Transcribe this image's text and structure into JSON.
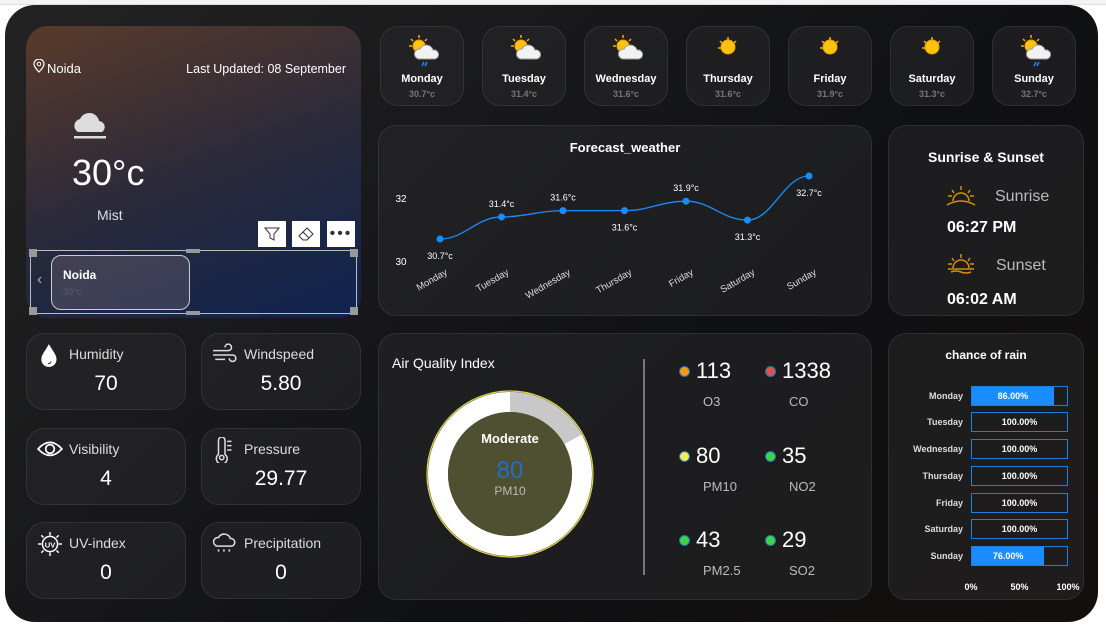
{
  "location": {
    "city": "Noida",
    "last_updated": "Last Updated: 08 September",
    "temp": "30°c",
    "condition": "Mist",
    "icon": "cloud-icon"
  },
  "slicer": {
    "item": "Noida",
    "sub": "30°c"
  },
  "days": [
    {
      "name": "Monday",
      "temp": "30.7°c",
      "icon": "sun-cloud-rain"
    },
    {
      "name": "Tuesday",
      "temp": "31.4°c",
      "icon": "sun-cloud"
    },
    {
      "name": "Wednesday",
      "temp": "31.6°c",
      "icon": "sun-cloud"
    },
    {
      "name": "Thursday",
      "temp": "31.6°c",
      "icon": "sun"
    },
    {
      "name": "Friday",
      "temp": "31.9°c",
      "icon": "sun"
    },
    {
      "name": "Saturday",
      "temp": "31.3°c",
      "icon": "sun"
    },
    {
      "name": "Sunday",
      "temp": "32.7°c",
      "icon": "sun-cloud-rain"
    }
  ],
  "chart_data": {
    "type": "line",
    "title": "Forecast_weather",
    "categories": [
      "Monday",
      "Tuesday",
      "Wednesday",
      "Thursday",
      "Friday",
      "Saturday",
      "Sunday"
    ],
    "values": [
      30.7,
      31.4,
      31.6,
      31.6,
      31.9,
      31.3,
      32.7
    ],
    "labels": [
      "30.7°c",
      "31.4°c",
      "31.6°c",
      "31.6°c",
      "31.9°c",
      "31.3°c",
      "32.7°c"
    ],
    "yticks": [
      "30",
      "32"
    ],
    "color": "#1a8cff"
  },
  "sun": {
    "title": "Sunrise & Sunset",
    "sunrise_label": "Sunrise",
    "sunrise": "06:27 PM",
    "sunset_label": "Sunset",
    "sunset": "06:02 AM",
    "icon_color": "#d4900a"
  },
  "metrics": [
    {
      "label": "Humidity",
      "value": "70",
      "icon": "droplet-icon"
    },
    {
      "label": "Windspeed",
      "value": "5.80",
      "icon": "wind-icon"
    },
    {
      "label": "Visibility",
      "value": "4",
      "icon": "eye-icon"
    },
    {
      "label": "Pressure",
      "value": "29.77",
      "icon": "thermometer-icon"
    },
    {
      "label": "UV-index",
      "value": "0",
      "icon": "uv-icon"
    },
    {
      "label": "Precipitation",
      "value": "0",
      "icon": "rain-cloud-icon"
    }
  ],
  "aqi": {
    "title": "Air Quality Index",
    "status": "Moderate",
    "value": "80",
    "pollutant": "PM10",
    "gauge_fraction": 0.17,
    "items": [
      {
        "value": "113",
        "label": "O3",
        "color": "#f59a0c"
      },
      {
        "value": "1338",
        "label": "CO",
        "color": "#d9534f"
      },
      {
        "value": "80",
        "label": "PM10",
        "color": "#f4ea5c"
      },
      {
        "value": "35",
        "label": "NO2",
        "color": "#3ed44a"
      },
      {
        "value": "43",
        "label": "PM2.5",
        "color": "#3ed44a"
      },
      {
        "value": "29",
        "label": "SO2",
        "color": "#3ed44a"
      }
    ]
  },
  "rain": {
    "title": "chance of rain",
    "days": [
      "Monday",
      "Tuesday",
      "Wednesday",
      "Thursday",
      "Friday",
      "Saturday",
      "Sunday"
    ],
    "values": [
      86,
      100,
      100,
      100,
      100,
      100,
      76
    ],
    "labels": [
      "86.00%",
      "100.00%",
      "100.00%",
      "100.00%",
      "100.00%",
      "100.00%",
      "76.00%"
    ],
    "ticks": [
      "0%",
      "50%",
      "100%"
    ]
  }
}
